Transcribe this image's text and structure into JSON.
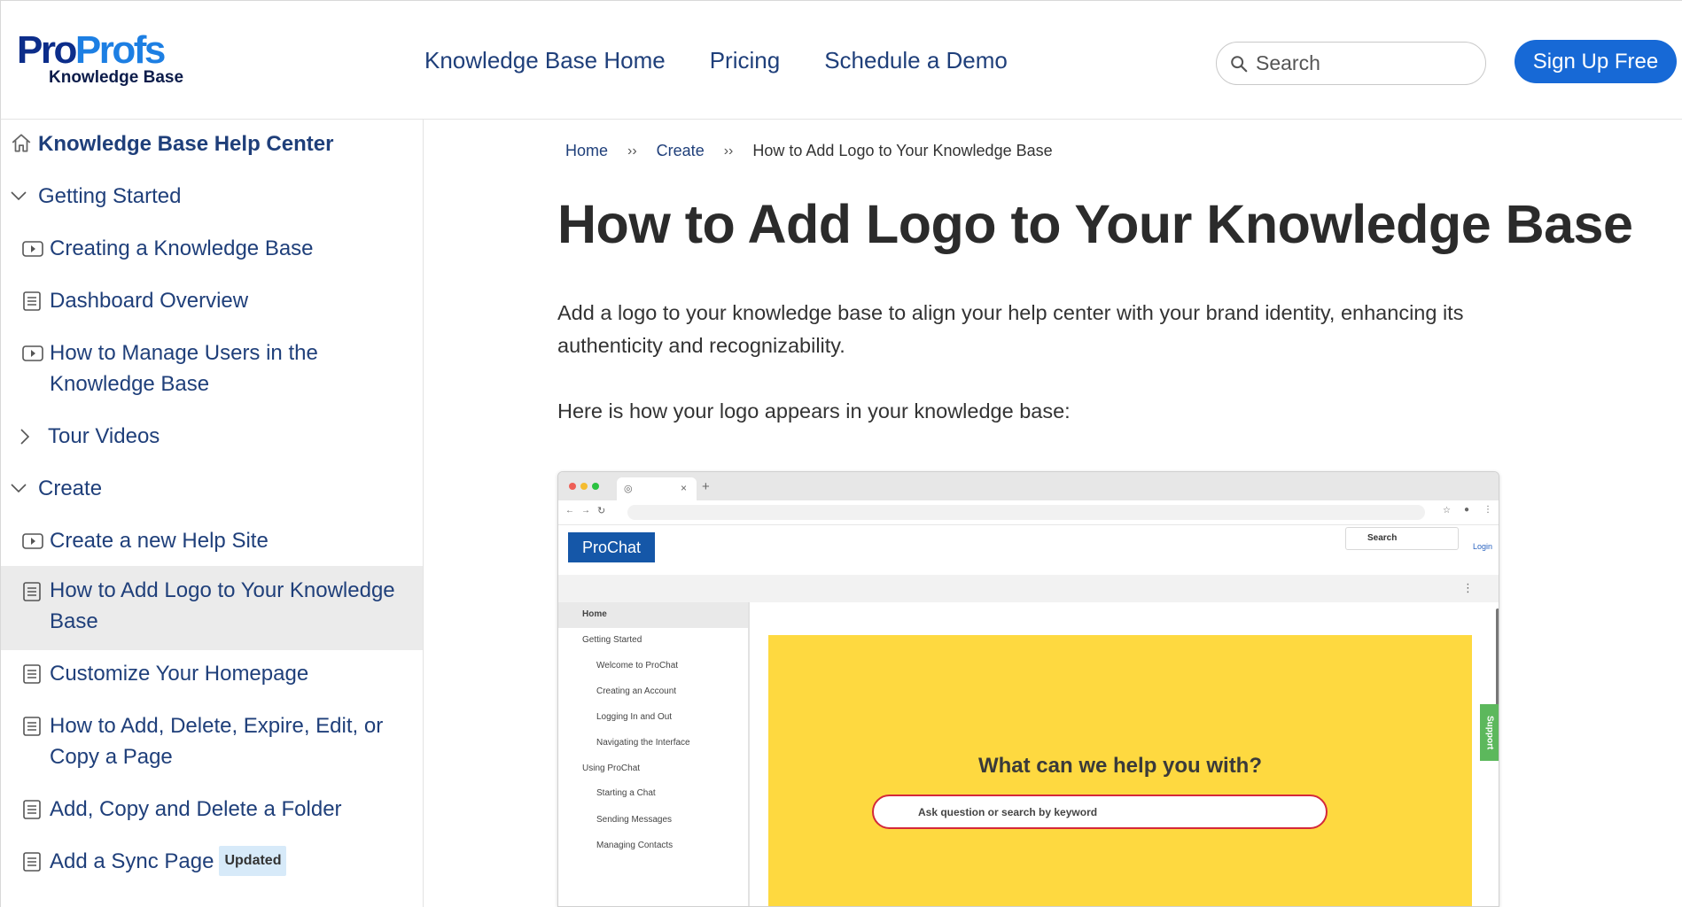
{
  "header": {
    "logo": {
      "word_pro": "Pro",
      "word_profs": "Profs",
      "subtitle": "Knowledge Base"
    },
    "nav": [
      "Knowledge Base Home",
      "Pricing",
      "Schedule a Demo"
    ],
    "search_placeholder": "Search",
    "signup_label": "Sign Up Free"
  },
  "sidebar": {
    "home_label": "Knowledge Base Help Center",
    "items": [
      {
        "label": "Getting Started",
        "icon": "chevron-down-icon",
        "kind": "section"
      },
      {
        "label": "Creating a Knowledge Base",
        "icon": "video-icon",
        "kind": "article"
      },
      {
        "label": "Dashboard Overview",
        "icon": "document-icon",
        "kind": "article"
      },
      {
        "label": "How to Manage Users in the Knowledge Base",
        "icon": "video-icon",
        "kind": "article"
      },
      {
        "label": "Tour Videos",
        "icon": "chevron-right-icon",
        "kind": "section"
      },
      {
        "label": "Create",
        "icon": "chevron-down-icon",
        "kind": "section"
      },
      {
        "label": "Create a new Help Site",
        "icon": "video-icon",
        "kind": "article"
      },
      {
        "label": "How to Add Logo to Your Knowledge Base",
        "icon": "document-icon",
        "kind": "article",
        "active": true
      },
      {
        "label": "Customize Your Homepage",
        "icon": "document-icon",
        "kind": "article"
      },
      {
        "label": "How to Add, Delete, Expire, Edit, or Copy a Page",
        "icon": "document-icon",
        "kind": "article"
      },
      {
        "label": "Add, Copy and Delete a Folder",
        "icon": "document-icon",
        "kind": "article"
      },
      {
        "label": "Add a Sync Page",
        "icon": "document-icon",
        "kind": "article",
        "badge": "Updated"
      }
    ]
  },
  "breadcrumb": {
    "items": [
      "Home",
      "Create"
    ],
    "separator": "››",
    "current": "How to Add Logo to Your Knowledge Base"
  },
  "article": {
    "title": "How to Add Logo to Your Knowledge Base",
    "intro": "Add a logo to your knowledge base to align your help center with your brand identity, enhancing its authenticity and recognizability.",
    "lead": "Here is how your logo appears in your knowledge base:"
  },
  "screenshot": {
    "brand": "ProChat",
    "search": "Search",
    "login": "Login",
    "sidebar_home": "Home",
    "sidebar_sections": [
      {
        "label": "Getting Started",
        "items": [
          "Welcome to ProChat",
          "Creating an Account",
          "Logging In and Out",
          "Navigating the Interface"
        ]
      },
      {
        "label": "Using ProChat",
        "items": [
          "Starting a Chat",
          "Sending Messages",
          "Managing Contacts"
        ]
      }
    ],
    "hero_title": "What can we help you with?",
    "hero_placeholder": "Ask question or search by keyword",
    "support_tab": "Support"
  },
  "colors": {
    "brand_dark": "#0c2d8a",
    "brand_light": "#1d7fe3",
    "link": "#1f3f7a",
    "button": "#1769d6",
    "active_bg": "#ebebeb",
    "badge_bg": "#d7eaf9",
    "hero_yellow": "#fed940"
  }
}
